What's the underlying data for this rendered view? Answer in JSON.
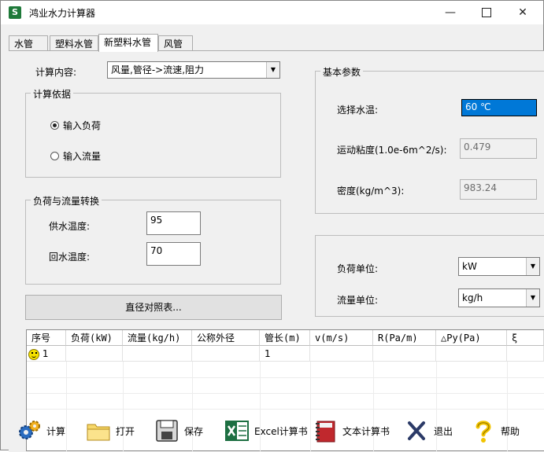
{
  "window": {
    "title": "鸿业水力计算器",
    "icon_letter": "S"
  },
  "tabs": [
    "水管",
    "塑料水管",
    "新塑料水管",
    "风管"
  ],
  "calc": {
    "label": "计算内容:",
    "value": "风量,管径->流速,阻力"
  },
  "basis": {
    "title": "计算依据",
    "option1": "输入负荷",
    "option2": "输入流量",
    "selected": "输入负荷"
  },
  "conversion": {
    "title": "负荷与流量转换",
    "supply_label": "供水温度:",
    "supply_value": "95",
    "return_label": "回水温度:",
    "return_value": "70"
  },
  "diameter_button": "直径对照表...",
  "params": {
    "title": "基本参数",
    "temp_label": "选择水温:",
    "temp_value": "60 ℃",
    "viscosity_label": "运动粘度(1.0e-6m^2/s):",
    "viscosity_value": "0.479",
    "density_label": "密度(kg/m^3):",
    "density_value": "983.24"
  },
  "units": {
    "load_label": "负荷单位:",
    "load_value": "kW",
    "flow_label": "流量单位:",
    "flow_value": "kg/h"
  },
  "grid": {
    "headers": [
      "序号",
      "负荷(kW)",
      "流量(kg/h)",
      "公称外径",
      "管长(m)",
      "v(m/s)",
      "R(Pa/m)",
      "△Py(Pa)",
      "ξ"
    ],
    "rows": [
      {
        "no": "1",
        "length": "1"
      }
    ]
  },
  "toolbar": {
    "calc": "计算",
    "open": "打开",
    "save": "保存",
    "excel": "Excel计算书",
    "text": "文本计算书",
    "exit": "退出",
    "help": "帮助"
  },
  "colors": {
    "selection": "#0078d7",
    "app_icon": "#1f7a3a"
  }
}
